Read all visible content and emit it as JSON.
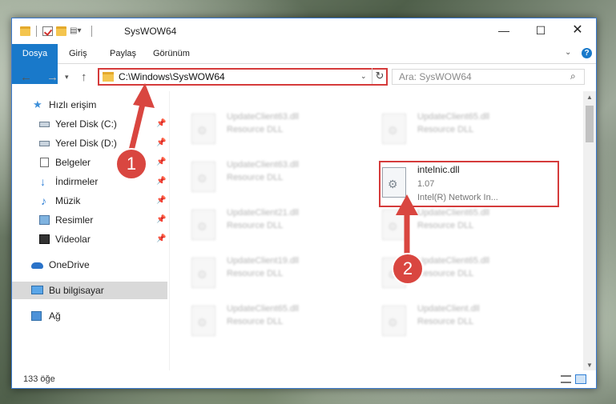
{
  "window": {
    "title": "SysWOW64",
    "controls": {
      "minimize": "—",
      "maximize": "☐",
      "close": "✕"
    }
  },
  "ribbon": {
    "tabs": [
      "Dosya",
      "Giriş",
      "Paylaş",
      "Görünüm"
    ]
  },
  "navigation": {
    "address": "C:\\Windows\\SysWOW64",
    "search_placeholder": "Ara: SysWOW64"
  },
  "sidebar": {
    "items": [
      {
        "label": "Hızlı erişim",
        "icon": "star-icon"
      },
      {
        "label": "Yerel Disk (C:)",
        "icon": "disk-icon",
        "pinned": true
      },
      {
        "label": "Yerel Disk (D:)",
        "icon": "disk-icon",
        "pinned": true
      },
      {
        "label": "Belgeler",
        "icon": "document-icon",
        "pinned": true
      },
      {
        "label": "İndirmeler",
        "icon": "download-icon",
        "pinned": true
      },
      {
        "label": "Müzik",
        "icon": "music-icon",
        "pinned": true
      },
      {
        "label": "Resimler",
        "icon": "pictures-icon",
        "pinned": true
      },
      {
        "label": "Videolar",
        "icon": "video-icon",
        "pinned": true
      },
      {
        "label": "OneDrive",
        "icon": "cloud-icon"
      },
      {
        "label": "Bu bilgisayar",
        "icon": "computer-icon",
        "selected": true
      },
      {
        "label": "Ağ",
        "icon": "network-icon"
      }
    ]
  },
  "files": [
    {
      "name": "UpdateClient63.dll",
      "desc": "Resource DLL"
    },
    {
      "name": "UpdateClient65.dll",
      "desc": "Resource DLL"
    },
    {
      "name": "UpdateClient63.dll",
      "desc": "Resource DLL"
    },
    {
      "name": "intelnic.dll",
      "version": "1.07",
      "desc": "Intel(R) Network In...",
      "selected": true
    },
    {
      "name": "UpdateClient21.dll",
      "desc": "Resource DLL"
    },
    {
      "name": "UpdateClient65.dll",
      "desc": "Resource DLL"
    },
    {
      "name": "UpdateClient19.dll",
      "desc": "Resource DLL"
    },
    {
      "name": "UpdateClient65.dll",
      "desc": "Resource DLL"
    },
    {
      "name": "UpdateClient65.dll",
      "desc": "Resource DLL"
    },
    {
      "name": "UpdateClient.dll",
      "desc": "Resource DLL"
    }
  ],
  "status": {
    "count": "133 öğe"
  },
  "annotations": {
    "step1": "1",
    "step2": "2",
    "color": "#d94640"
  }
}
